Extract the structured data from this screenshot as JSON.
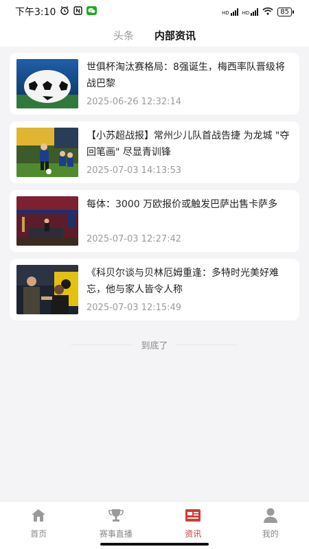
{
  "status_bar": {
    "time": "下午3:10",
    "net1": "HD",
    "net2": "HD",
    "battery": "85"
  },
  "tabs": [
    {
      "label": "头条",
      "active": false
    },
    {
      "label": "内部资讯",
      "active": true
    }
  ],
  "articles": [
    {
      "title": "世俱杯淘汰赛格局：8强诞生，梅西率队晋级将战巴黎",
      "time": "2025-06-26 12:32:14"
    },
    {
      "title": "【小苏超战报】常州少儿队首战告捷 为龙城 \"夺回笔画\" 尽显青训锋",
      "time": "2025-07-03 14:13:53"
    },
    {
      "title": "每体：3000 万欧报价或触发巴萨出售卡萨多",
      "time": "2025-07-03 12:27:42"
    },
    {
      "title": "《科贝尔谈与贝林厄姆重逢：多特时光美好难忘，他与家人皆令人称",
      "time": "2025-07-03 12:15:49"
    }
  ],
  "end_text": "到底了",
  "bottom_nav": [
    {
      "label": "首页",
      "icon": "home-icon",
      "active": false
    },
    {
      "label": "赛事直播",
      "icon": "trophy-icon",
      "active": false
    },
    {
      "label": "资讯",
      "icon": "news-icon",
      "active": true
    },
    {
      "label": "我的",
      "icon": "profile-icon",
      "active": false
    }
  ],
  "colors": {
    "accent": "#d23a35",
    "inactive": "#888888",
    "background": "#f4f4f6"
  }
}
